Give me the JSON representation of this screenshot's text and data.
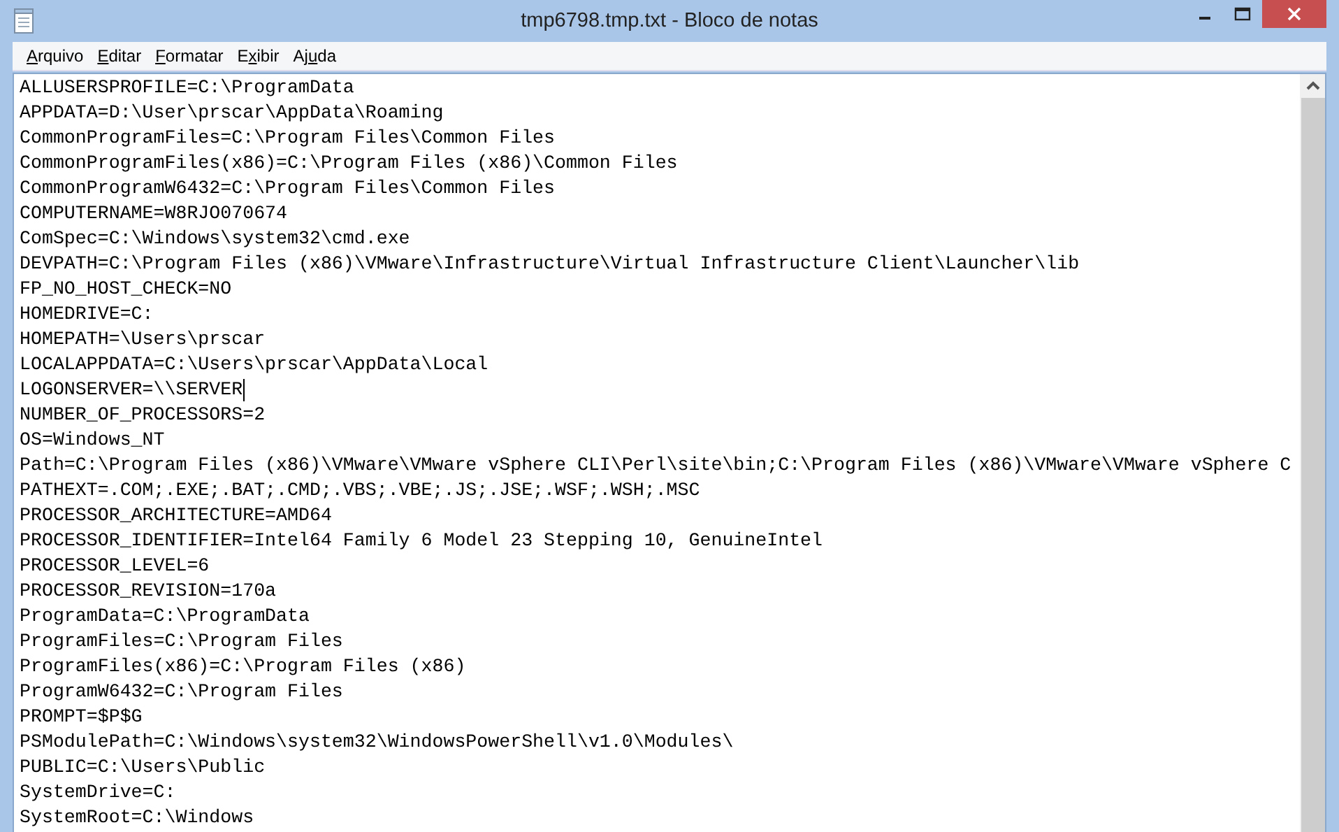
{
  "window": {
    "title": "tmp6798.tmp.txt - Bloco de notas"
  },
  "menu": [
    {
      "key": "A",
      "after": "rquivo"
    },
    {
      "key": "E",
      "after": "ditar"
    },
    {
      "key": "F",
      "after": "ormatar"
    },
    {
      "before": "E",
      "key": "x",
      "after": "ibir"
    },
    {
      "before": "Aj",
      "key": "u",
      "after": "da"
    }
  ],
  "lines": [
    {
      "text": "ALLUSERSPROFILE=C:\\ProgramData",
      "caret": false
    },
    {
      "text": "APPDATA=D:\\User\\prscar\\AppData\\Roaming",
      "caret": false
    },
    {
      "text": "CommonProgramFiles=C:\\Program Files\\Common Files",
      "caret": false
    },
    {
      "text": "CommonProgramFiles(x86)=C:\\Program Files (x86)\\Common Files",
      "caret": false
    },
    {
      "text": "CommonProgramW6432=C:\\Program Files\\Common Files",
      "caret": false
    },
    {
      "text": "COMPUTERNAME=W8RJO070674",
      "caret": false
    },
    {
      "text": "ComSpec=C:\\Windows\\system32\\cmd.exe",
      "caret": false
    },
    {
      "text": "DEVPATH=C:\\Program Files (x86)\\VMware\\Infrastructure\\Virtual Infrastructure Client\\Launcher\\lib",
      "caret": false
    },
    {
      "text": "FP_NO_HOST_CHECK=NO",
      "caret": false
    },
    {
      "text": "HOMEDRIVE=C:",
      "caret": false
    },
    {
      "text": "HOMEPATH=\\Users\\prscar",
      "caret": false
    },
    {
      "text": "LOCALAPPDATA=C:\\Users\\prscar\\AppData\\Local",
      "caret": false
    },
    {
      "text": "LOGONSERVER=\\\\SERVER",
      "caret": true
    },
    {
      "text": "NUMBER_OF_PROCESSORS=2",
      "caret": false
    },
    {
      "text": "OS=Windows_NT",
      "caret": false
    },
    {
      "text": "Path=C:\\Program Files (x86)\\VMware\\VMware vSphere CLI\\Perl\\site\\bin;C:\\Program Files (x86)\\VMware\\VMware vSphere C",
      "caret": false
    },
    {
      "text": "PATHEXT=.COM;.EXE;.BAT;.CMD;.VBS;.VBE;.JS;.JSE;.WSF;.WSH;.MSC",
      "caret": false
    },
    {
      "text": "PROCESSOR_ARCHITECTURE=AMD64",
      "caret": false
    },
    {
      "text": "PROCESSOR_IDENTIFIER=Intel64 Family 6 Model 23 Stepping 10, GenuineIntel",
      "caret": false
    },
    {
      "text": "PROCESSOR_LEVEL=6",
      "caret": false
    },
    {
      "text": "PROCESSOR_REVISION=170a",
      "caret": false
    },
    {
      "text": "ProgramData=C:\\ProgramData",
      "caret": false
    },
    {
      "text": "ProgramFiles=C:\\Program Files",
      "caret": false
    },
    {
      "text": "ProgramFiles(x86)=C:\\Program Files (x86)",
      "caret": false
    },
    {
      "text": "ProgramW6432=C:\\Program Files",
      "caret": false
    },
    {
      "text": "PROMPT=$P$G",
      "caret": false
    },
    {
      "text": "PSModulePath=C:\\Windows\\system32\\WindowsPowerShell\\v1.0\\Modules\\",
      "caret": false
    },
    {
      "text": "PUBLIC=C:\\Users\\Public",
      "caret": false
    },
    {
      "text": "SystemDrive=C:",
      "caret": false
    },
    {
      "text": "SystemRoot=C:\\Windows",
      "caret": false
    }
  ]
}
